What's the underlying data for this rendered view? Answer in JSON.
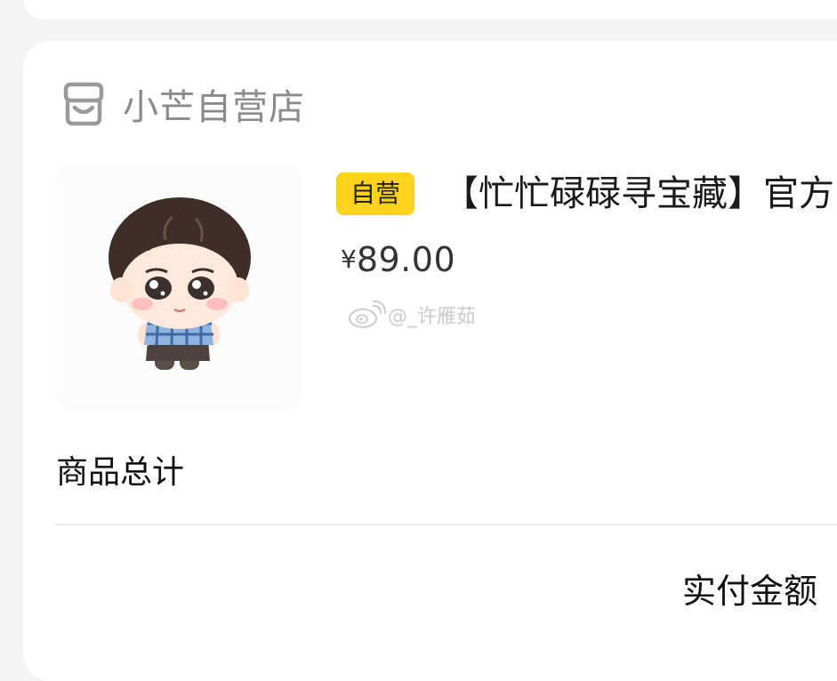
{
  "store": {
    "name": "小芒自营店",
    "icon": "store-icon"
  },
  "product": {
    "badge": "自营",
    "title": "【忙忙碌碌寻宝藏】官方",
    "price_currency": "¥",
    "price_amount": "89.00",
    "image": "chibi-plush-doll"
  },
  "watermark": {
    "icon": "weibo-icon",
    "text": "@_许雁茹"
  },
  "summary": {
    "total_label": "商品总计",
    "paid_label": "实付金额"
  },
  "colors": {
    "badge": "#ffd21e",
    "store_text": "#8a8a8a",
    "background": "#f4f4f4",
    "card": "#ffffff"
  }
}
